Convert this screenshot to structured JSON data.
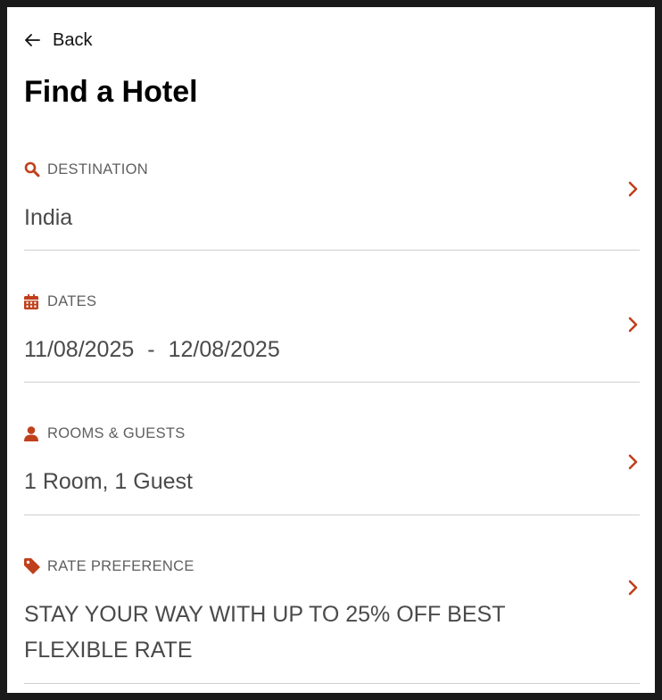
{
  "nav": {
    "back_label": "Back"
  },
  "page": {
    "title": "Find a Hotel"
  },
  "accent_color": "#c0401c",
  "sections": {
    "destination": {
      "label": "DESTINATION",
      "value": "India",
      "icon": "search-icon"
    },
    "dates": {
      "label": "DATES",
      "start": "11/08/2025",
      "separator": "-",
      "end": "12/08/2025",
      "icon": "calendar-icon"
    },
    "rooms": {
      "label": "ROOMS & GUESTS",
      "value": "1 Room, 1 Guest",
      "icon": "person-icon"
    },
    "rate": {
      "label": "RATE PREFERENCE",
      "value": "STAY YOUR WAY WITH UP TO 25% OFF BEST FLEXIBLE RATE",
      "icon": "tag-icon"
    }
  }
}
